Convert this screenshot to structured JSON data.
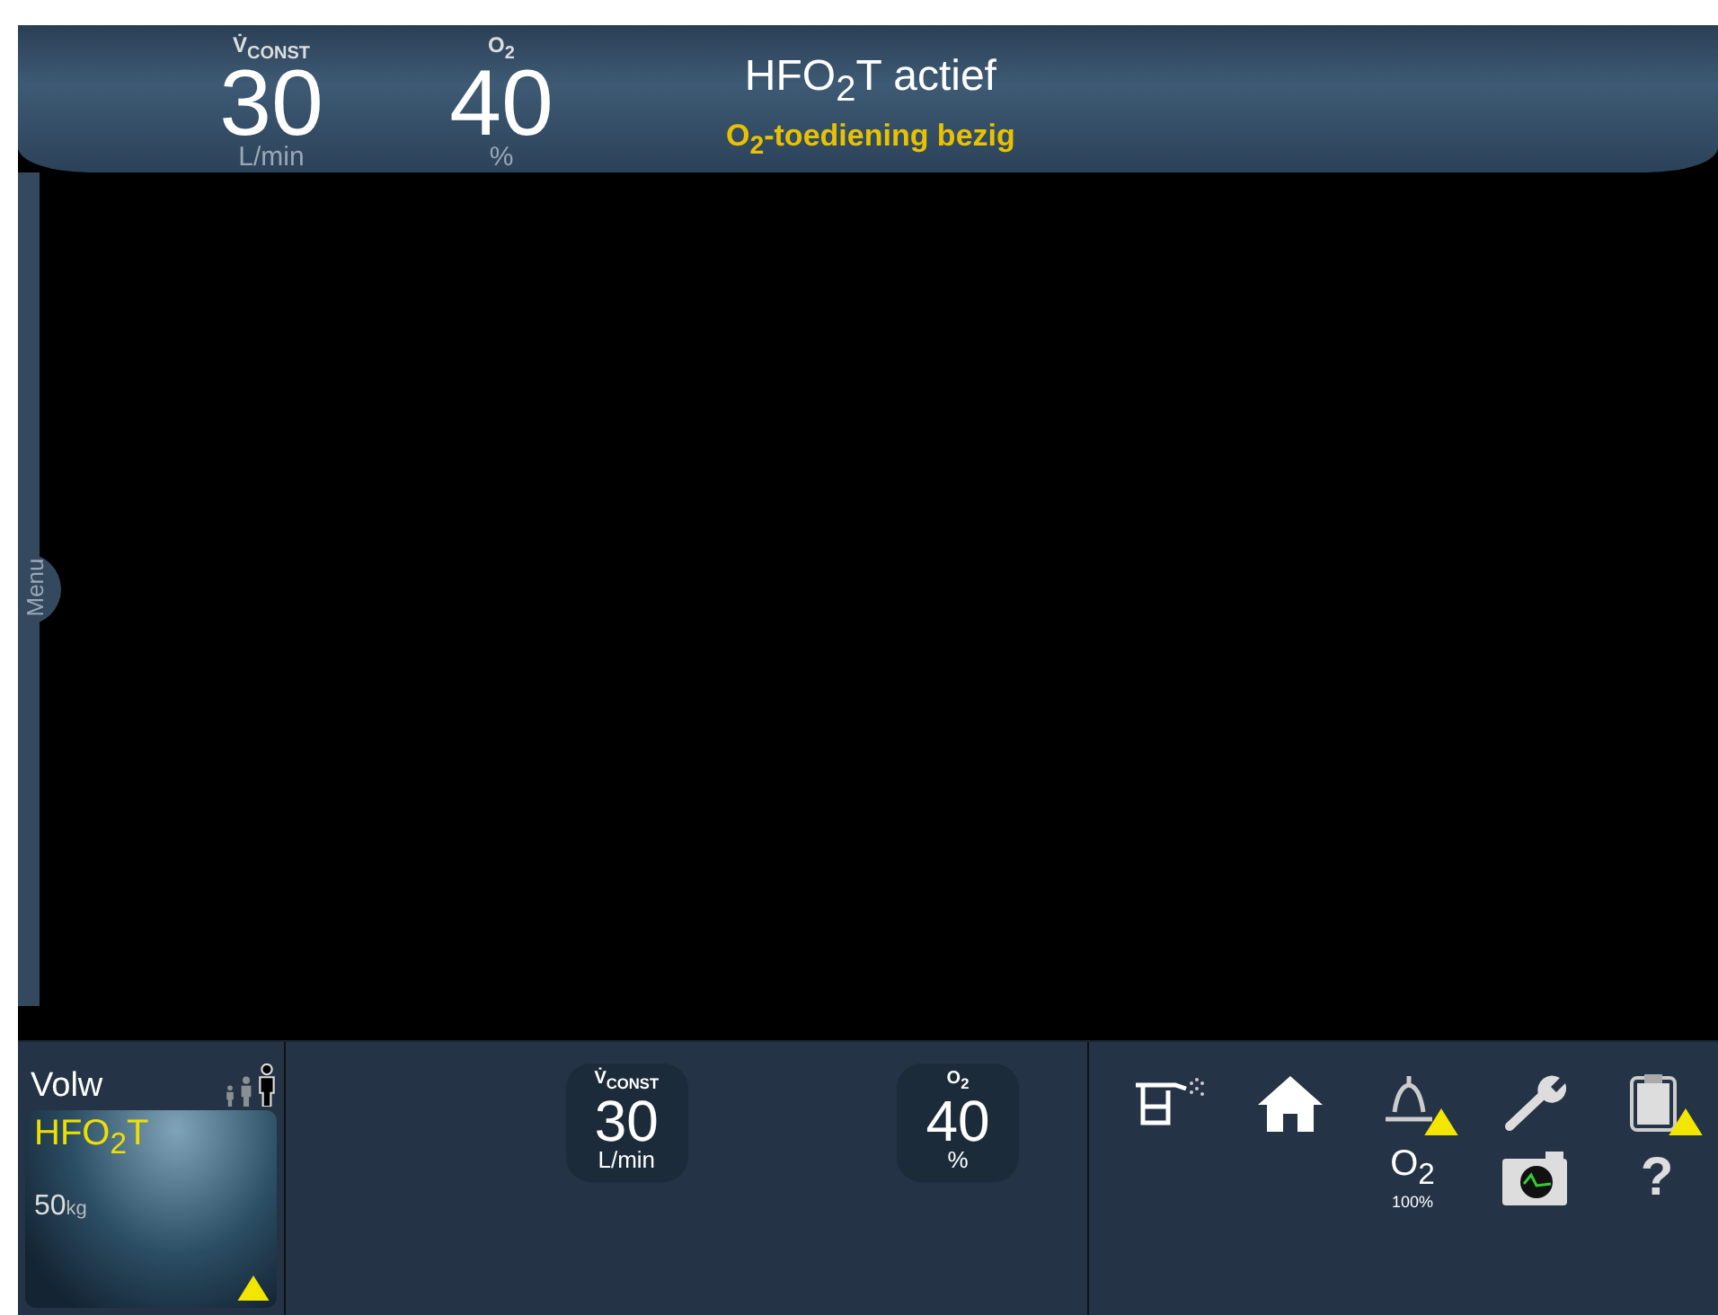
{
  "header": {
    "readouts": [
      {
        "label": "V̇$_{CONST}$",
        "value": "30",
        "unit": "L/min"
      },
      {
        "label": "O$_{2}$",
        "value": "40",
        "unit": "%"
      }
    ],
    "title": "HFO$_{2}$T actief",
    "status": "O$_{2}$-toediening bezig"
  },
  "menu": {
    "label": "Menu"
  },
  "patient": {
    "category": "Volw",
    "types": [
      {
        "kind": "neonatal",
        "selected": false
      },
      {
        "kind": "child",
        "selected": false
      },
      {
        "kind": "adult",
        "selected": true
      }
    ],
    "mode": "HFO$_{2}$T",
    "weight": "50",
    "weight_unit": "kg",
    "alert": true
  },
  "settings": [
    {
      "label": "V̇$_{CONST}$",
      "value": "30",
      "unit": "L/min"
    },
    {
      "label": "O$_{2}$",
      "value": "40",
      "unit": "%"
    }
  ],
  "tools": [
    {
      "kind": "nebulizer",
      "alert": false
    },
    {
      "kind": "home",
      "alert": false
    },
    {
      "kind": "alarm",
      "alert": true
    },
    {
      "kind": "wrench",
      "alert": false
    },
    {
      "kind": "log",
      "alert": true
    },
    {
      "kind": "o2",
      "label": "O$_{2}$",
      "sub": "100%",
      "alert": false
    },
    {
      "kind": "camera",
      "alert": false
    },
    {
      "kind": "help",
      "label": "?",
      "alert": false
    }
  ]
}
